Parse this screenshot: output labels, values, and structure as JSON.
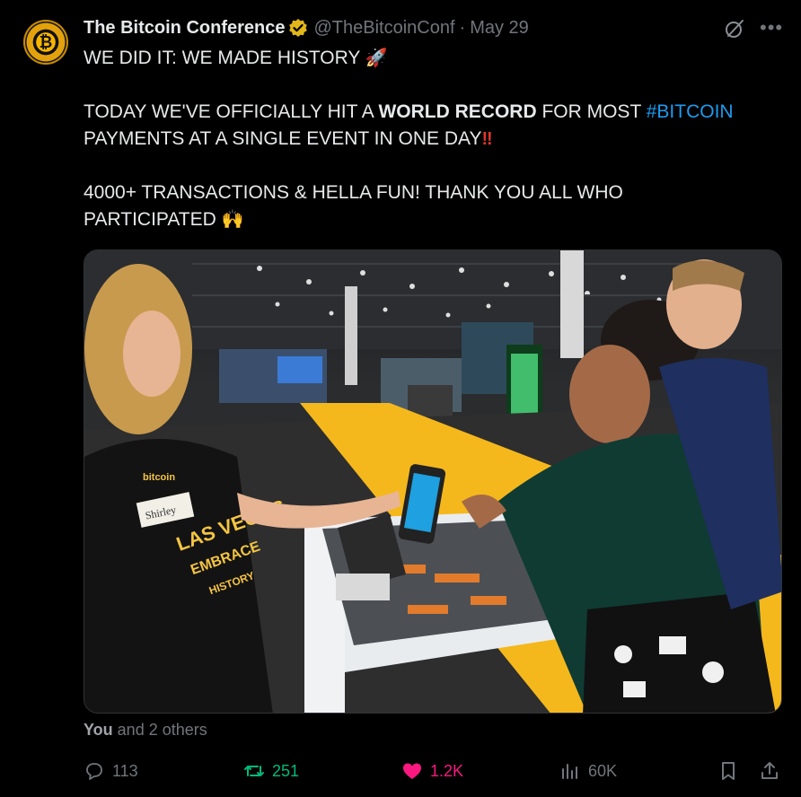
{
  "author": {
    "name": "The Bitcoin Conference",
    "handle": "@TheBitcoinConf",
    "separator": "·",
    "date": "May 29"
  },
  "tweet": {
    "line1": "WE DID IT: WE MADE HISTORY",
    "line2_a": "TODAY WE'VE OFFICIALLY HIT A ",
    "line2_bold": "WORLD RECORD",
    "line2_b": " FOR MOST ",
    "line2_tag": "#BITCOIN",
    "line3": "PAYMENTS AT A SINGLE EVENT IN ONE DAY",
    "line4": "4000+ TRANSACTIONS & HELLA FUN! THANK YOU ALL WHO",
    "line5": "PARTICIPATED"
  },
  "media": {
    "shirt_brand": "bitcoin",
    "name_tag": "Shirley",
    "shirt_lines": [
      "LAS VEGAS",
      "EMBRACE",
      "HISTORY"
    ]
  },
  "liked_by": {
    "you": "You",
    "rest": " and 2 others"
  },
  "actions": {
    "replies": "113",
    "reposts": "251",
    "likes": "1.2K",
    "views": "60K"
  },
  "colors": {
    "accent": "#1d9bf0",
    "repost": "#00ba7c",
    "like": "#f91880",
    "muted": "#71767b"
  }
}
